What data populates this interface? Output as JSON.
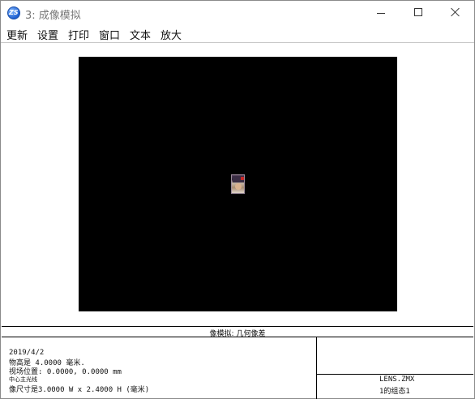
{
  "window": {
    "title": "3: 成像模拟",
    "app_icon_text": "ZS"
  },
  "menu": {
    "items": [
      "更新",
      "设置",
      "打印",
      "窗口",
      "文本",
      "放大"
    ]
  },
  "panel": {
    "title": "像模拟: 几何像差",
    "left_lines": [
      "2019/4/2",
      "物高是 4.0000 毫米.",
      "视场位置: 0.0000, 0.0000 mm",
      "中心主光线",
      "像尺寸是3.0000 W x 2.4000 H (毫米)"
    ],
    "right_lines": [
      "LENS.ZMX",
      "1的组态1"
    ]
  },
  "colors": {
    "image_background": "#000000",
    "window_border": "#8a8a8a"
  }
}
